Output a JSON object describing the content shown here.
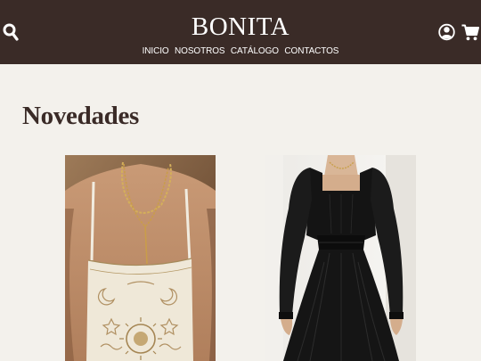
{
  "header": {
    "brand": "BONITA",
    "nav": [
      {
        "label": "INICIO"
      },
      {
        "label": "NOSOTROS"
      },
      {
        "label": "CATÁLOGO"
      },
      {
        "label": "CONTACTOS"
      }
    ],
    "icons": [
      "search-icon",
      "user-icon",
      "cart-icon"
    ]
  },
  "main": {
    "section_title": "Novedades",
    "products": [
      {
        "image": "embroidered-cream-corset-top-with-gold-necklaces"
      },
      {
        "image": "black-square-neck-long-sleeve-dress"
      }
    ]
  },
  "colors": {
    "header_bg": "#3a2b27",
    "page_bg": "#f3f1ec",
    "title_color": "#3a2b27"
  }
}
